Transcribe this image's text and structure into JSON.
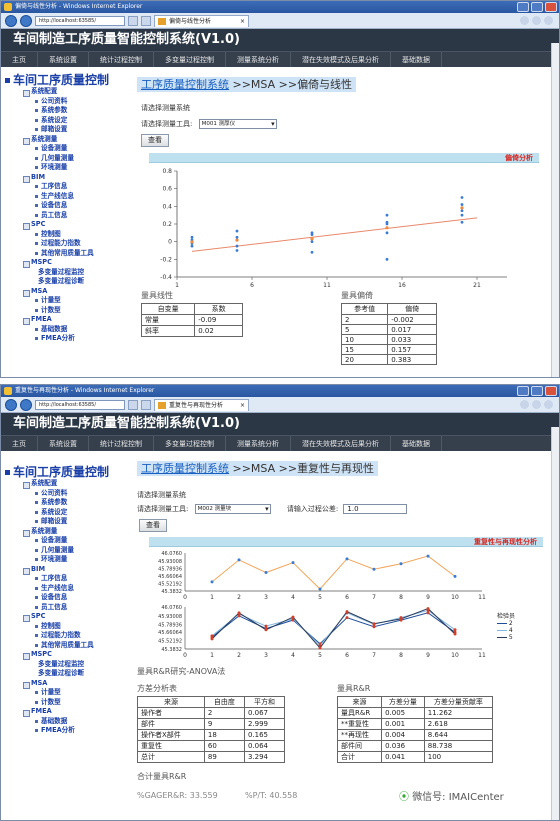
{
  "w1": {
    "title": "偏倚与线性分析 - Windows Internet Explorer",
    "url": "http://localhost:63585/",
    "tab": "偏倚与线性分析",
    "app_title": "车间制造工序质量智能控制系统(V1.0)",
    "menu": [
      "主页",
      "系统设置",
      "统计过程控制",
      "多变量过程控制",
      "测量系统分析",
      "潜在失效模式及后果分析",
      "基础数据"
    ],
    "sidebar_title": "车间工序质量控制",
    "sidebar": [
      {
        "g": "系统配置",
        "items": [
          "公司资料",
          "系统参数",
          "系统设定",
          "邮箱设置"
        ]
      },
      {
        "g": "系统测量",
        "items": [
          "设备测量",
          "几何量测量",
          "环境测量"
        ]
      },
      {
        "g": "BIM",
        "items": [
          "工序信息",
          "生产线信息",
          "设备信息",
          "员工信息"
        ]
      },
      {
        "g": "SPC",
        "items": [
          "控制图",
          "过程能力指数",
          "其他常用质量工具"
        ]
      },
      {
        "g": "MSPC",
        "items": [
          "多变量过程监控",
          "多变量过程诊断"
        ]
      },
      {
        "g": "MSA",
        "items": [
          "计量型",
          "计数型"
        ]
      },
      {
        "g": "FMEA",
        "items": [
          "基础数据",
          "FMEA分析"
        ]
      }
    ],
    "breadcrumb_link": "工序质量控制系统",
    "breadcrumb_rest": " >>MSA >>偏倚与线性",
    "select_label": "请选择测量系统",
    "tool_label": "请选择测量工具:",
    "tool_value": "M001 测厚仪",
    "query": "查看",
    "panel_title": "偏倚分析",
    "linearity_title": "量具线性",
    "linearity_head": [
      "自变量",
      "系数"
    ],
    "linearity_rows": [
      [
        "常量",
        "-0.09"
      ],
      [
        "斜率",
        "0.02"
      ]
    ],
    "bias_title": "量具偏倚",
    "bias_head": [
      "参考值",
      "偏倚"
    ],
    "bias_rows": [
      [
        "2",
        "-0.002"
      ],
      [
        "5",
        "0.017"
      ],
      [
        "10",
        "0.033"
      ],
      [
        "15",
        "0.157"
      ],
      [
        "20",
        "0.383"
      ]
    ]
  },
  "w2": {
    "title": "重复性与再现性分析 - Windows Internet Explorer",
    "url": "http://localhost:63585/",
    "tab": "重复性与再现性分析",
    "app_title": "车间制造工序质量智能控制系统(V1.0)",
    "menu": [
      "主页",
      "系统设置",
      "统计过程控制",
      "多变量过程控制",
      "测量系统分析",
      "潜在失效模式及后果分析",
      "基础数据"
    ],
    "sidebar_title": "车间工序质量控制",
    "sidebar": [
      {
        "g": "系统配置",
        "items": [
          "公司资料",
          "系统参数",
          "系统设定",
          "邮箱设置"
        ]
      },
      {
        "g": "系统测量",
        "items": [
          "设备测量",
          "几何量测量",
          "环境测量"
        ]
      },
      {
        "g": "BIM",
        "items": [
          "工序信息",
          "生产线信息",
          "设备信息",
          "员工信息"
        ]
      },
      {
        "g": "SPC",
        "items": [
          "控制图",
          "过程能力指数",
          "其他常用质量工具"
        ]
      },
      {
        "g": "MSPC",
        "items": [
          "多变量过程监控",
          "多变量过程诊断"
        ]
      },
      {
        "g": "MSA",
        "items": [
          "计量型",
          "计数型"
        ]
      },
      {
        "g": "FMEA",
        "items": [
          "基础数据",
          "FMEA分析"
        ]
      }
    ],
    "breadcrumb_link": "工序质量控制系统",
    "breadcrumb_rest": " >>MSA >>重复性与再现性",
    "select_label": "请选择测量系统",
    "tool_label": "请选择测量工具:",
    "tool_value": "M002 测量块",
    "tol_label": "请输入过程公差:",
    "tol_value": "1.0",
    "query": "查看",
    "panel_title": "重复性与再现性分析",
    "legend_title": "检验员",
    "legend": [
      "2",
      "4",
      "5"
    ],
    "study_title": "量具R&R研究-ANOVA法",
    "var_title": "方差分析表",
    "var_head": [
      "来源",
      "自由度",
      "平方和"
    ],
    "var_rows": [
      [
        "操作者",
        "2",
        "0.067"
      ],
      [
        "部件",
        "9",
        "2.999"
      ],
      [
        "操作者X部件",
        "18",
        "0.165"
      ],
      [
        "重复性",
        "60",
        "0.064"
      ],
      [
        "总计",
        "89",
        "3.294"
      ]
    ],
    "rr_title": "量具R&R",
    "rr_head": [
      "来源",
      "方差分量",
      "方差分量贡献率"
    ],
    "rr_rows": [
      [
        "量具R&R",
        "0.005",
        "11.262"
      ],
      [
        "**重复性",
        "0.001",
        "2.618"
      ],
      [
        "**再现性",
        "0.004",
        "8.644"
      ],
      [
        "部件间",
        "0.036",
        "88.738"
      ],
      [
        "合计",
        "0.041",
        "100"
      ]
    ],
    "total_title": "合计量具R&R",
    "footer1": "%GAGER&R: 33.559",
    "footer2": "%P/T: 40.558",
    "watermark": "微信号: IMAICenter"
  },
  "chart_data": [
    {
      "type": "scatter",
      "title": "偏倚分析",
      "xlim": [
        1,
        23
      ],
      "ylim": [
        -0.4,
        0.8
      ],
      "xticks": [
        1,
        6,
        11,
        16,
        21
      ],
      "yticks": [
        -0.4,
        -0.2,
        0,
        0.2,
        0.4,
        0.6,
        0.8
      ],
      "series": [
        {
          "values": [
            [
              2,
              0.02
            ],
            [
              2,
              0.05
            ],
            [
              2,
              -0.05
            ],
            [
              2,
              -0.02
            ],
            [
              2,
              0.0
            ],
            [
              5,
              0.12
            ],
            [
              5,
              0.05
            ],
            [
              5,
              -0.1
            ],
            [
              5,
              0.02
            ],
            [
              5,
              -0.05
            ],
            [
              10,
              0.1
            ],
            [
              10,
              0.03
            ],
            [
              10,
              -0.12
            ],
            [
              10,
              0.08
            ],
            [
              10,
              0.0
            ],
            [
              15,
              0.3
            ],
            [
              15,
              0.22
            ],
            [
              15,
              0.1
            ],
            [
              15,
              -0.2
            ],
            [
              15,
              0.2
            ],
            [
              20,
              0.5
            ],
            [
              20,
              0.42
            ],
            [
              20,
              0.35
            ],
            [
              20,
              0.3
            ],
            [
              20,
              0.22
            ]
          ]
        },
        {
          "values": [
            [
              2,
              -0.002
            ],
            [
              5,
              0.017
            ],
            [
              10,
              0.033
            ],
            [
              15,
              0.157
            ],
            [
              20,
              0.383
            ]
          ]
        }
      ],
      "fit": {
        "intercept": -0.09,
        "slope": 0.02
      }
    },
    {
      "type": "line",
      "x": [
        1,
        2,
        3,
        4,
        5,
        6,
        7,
        8,
        9,
        10
      ],
      "ylim": [
        45.3832,
        46.076
      ],
      "yticks": [
        "46.0760",
        "45.93008",
        "45.78936",
        "45.66064",
        "45.52192",
        "45.3832"
      ],
      "series": [
        {
          "values": [
            45.55,
            45.95,
            45.72,
            45.9,
            45.42,
            45.97,
            45.78,
            45.88,
            46.02,
            45.65
          ]
        }
      ]
    },
    {
      "type": "line",
      "x": [
        1,
        2,
        3,
        4,
        5,
        6,
        7,
        8,
        9,
        10
      ],
      "ylim": [
        45.3832,
        46.076
      ],
      "yticks": [
        "46.0760",
        "45.93008",
        "45.78936",
        "45.66064",
        "45.52192",
        "45.3832"
      ],
      "series": [
        {
          "name": "2",
          "values": [
            45.58,
            45.93,
            45.72,
            45.86,
            45.47,
            45.9,
            45.75,
            45.86,
            45.98,
            45.66
          ]
        },
        {
          "name": "4",
          "values": [
            45.6,
            45.96,
            45.76,
            45.88,
            45.44,
            45.98,
            45.79,
            45.9,
            46.02,
            45.7
          ]
        },
        {
          "name": "5",
          "values": [
            45.55,
            45.98,
            45.7,
            45.91,
            45.4,
            46.0,
            45.8,
            45.88,
            46.05,
            45.63
          ]
        }
      ]
    }
  ]
}
